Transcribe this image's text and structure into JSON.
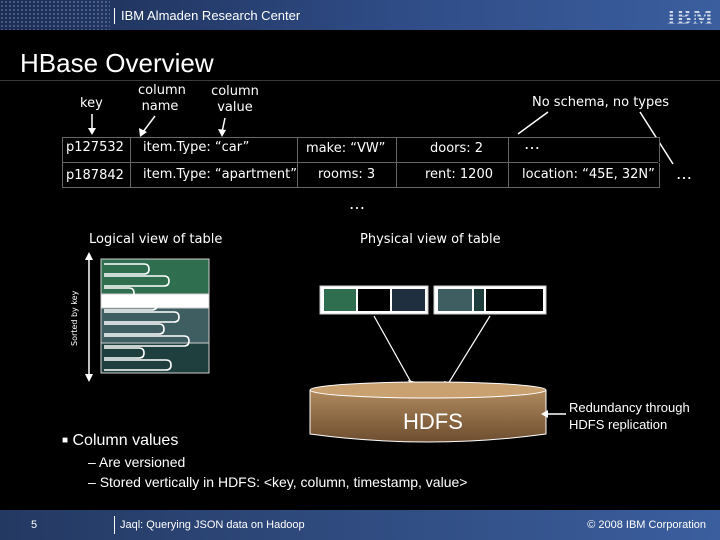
{
  "header": {
    "org": "IBM Almaden Research Center",
    "logo": "IBM"
  },
  "slide": {
    "title": "HBase Overview"
  },
  "columns": {
    "key": "key",
    "column_name": "column\nname",
    "column_value": "column\nvalue"
  },
  "note": "No schema, no types",
  "rows": [
    {
      "key": "p127532",
      "cells": [
        "item.Type: “car”",
        "make: “VW”",
        "doors: 2",
        "…"
      ]
    },
    {
      "key": "p187842",
      "cells": [
        "item.Type: “apartment”",
        "rooms: 3",
        "rent: 1200",
        "location: “45E, 32N”",
        "…"
      ]
    }
  ],
  "ellipsis": "…",
  "logical_label": "Logical view of table",
  "physical_label": "Physical view of table",
  "sorted_label": "Sorted by key",
  "hdfs_label": "HDFS",
  "redundancy_label": "Redundancy through\nHDFS replication",
  "bullets": {
    "main": "Column values",
    "subs": [
      "Are versioned",
      "Stored vertically in HDFS: <key, column, timestamp, value>"
    ]
  },
  "footer": {
    "page": "5",
    "talk": "Jaql: Querying JSON data on Hadoop",
    "copyright": "© 2008 IBM Corporation"
  },
  "colors": {
    "accent": "#3b5e9e",
    "hdfs": "#7a5a3a",
    "green": "#2f6f4f",
    "teal": "#3e5e62"
  }
}
